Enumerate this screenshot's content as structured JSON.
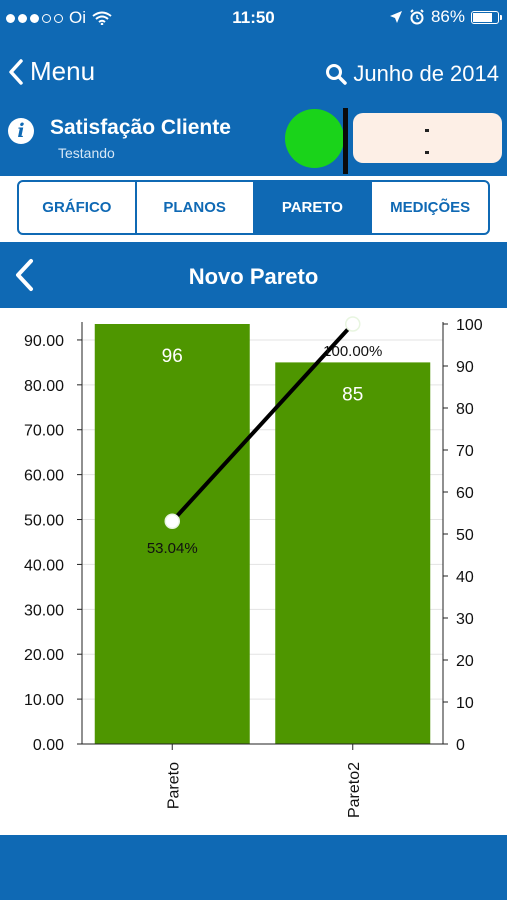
{
  "status_bar": {
    "carrier": "Oi",
    "time": "11:50",
    "battery": "86%",
    "battery_level": 0.86,
    "icons": [
      "signal-dots",
      "wifi-icon",
      "location-arrow-icon",
      "alarm-clock-icon",
      "battery-icon"
    ]
  },
  "nav": {
    "back_label": "Menu",
    "month_label": "Junho de 2014"
  },
  "indicator": {
    "title": "Satisfação Cliente",
    "subtitle": "Testando",
    "status_color": "#1ad31a"
  },
  "tabs": [
    {
      "label": "GRÁFICO",
      "active": false
    },
    {
      "label": "PLANOS",
      "active": false
    },
    {
      "label": "PARETO",
      "active": true
    },
    {
      "label": "MEDIÇÕES",
      "active": false
    }
  ],
  "section": {
    "title": "Novo Pareto"
  },
  "colors": {
    "brand_blue": "#0f69b4",
    "bar_green": "#4e9600",
    "line": "#000000"
  },
  "chart_data": {
    "type": "bar",
    "categories": [
      "Pareto",
      "Pareto2"
    ],
    "values": [
      96,
      85
    ],
    "value_labels": [
      "96",
      "85"
    ],
    "left_axis": {
      "ylim": [
        0,
        95
      ],
      "ticks": [
        "0.00",
        "10.00",
        "20.00",
        "30.00",
        "40.00",
        "50.00",
        "60.00",
        "70.00",
        "80.00",
        "90.00"
      ]
    },
    "right_axis": {
      "ylim": [
        0,
        100
      ],
      "ticks": [
        "0",
        "10",
        "20",
        "30",
        "40",
        "50",
        "60",
        "70",
        "80",
        "90",
        "100"
      ]
    },
    "cumulative_line": {
      "values": [
        53.04,
        100.0
      ],
      "labels": [
        "53.04%",
        "100.00%"
      ]
    },
    "grid": true,
    "legend": "none"
  }
}
